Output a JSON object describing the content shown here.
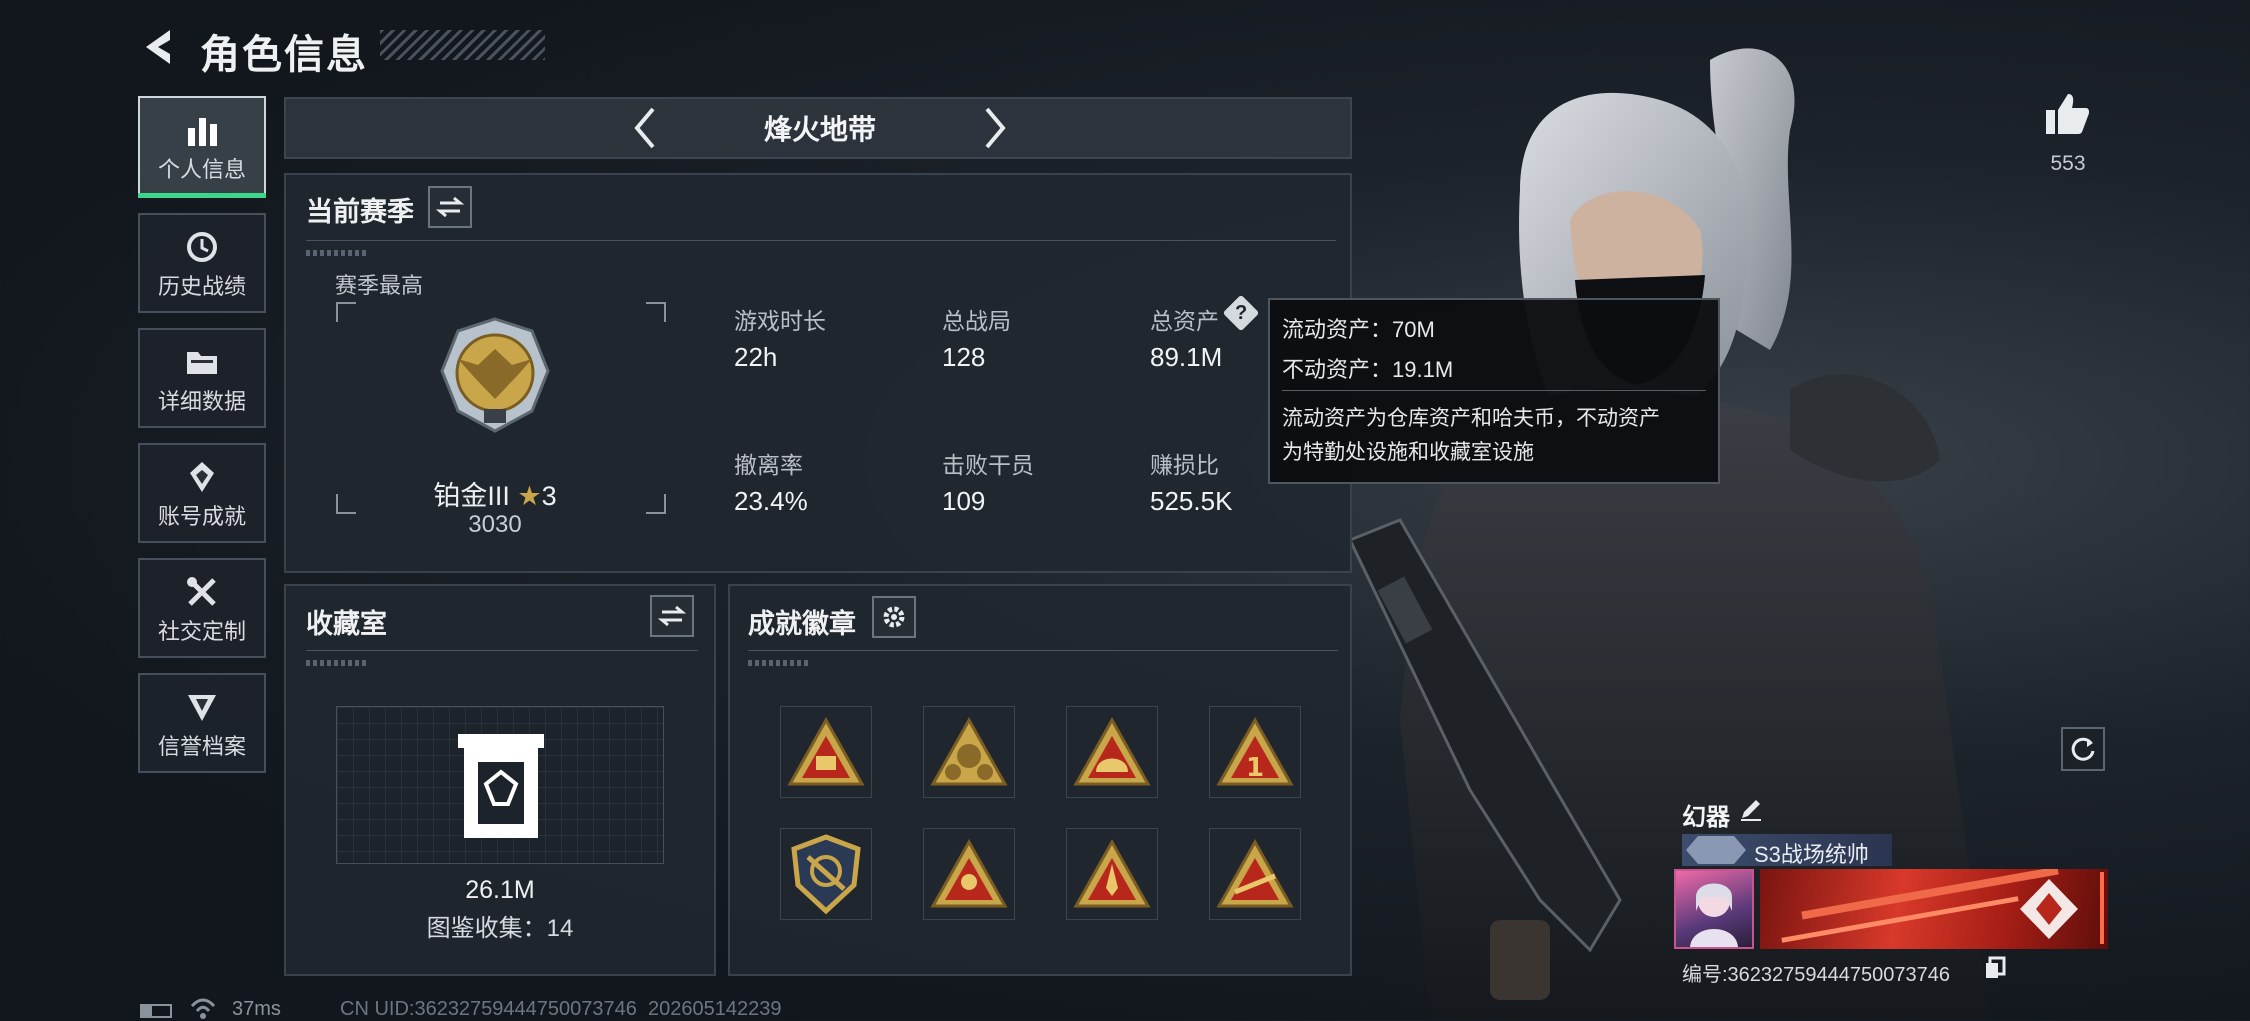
{
  "header": {
    "title": "角色信息",
    "back_icon": "back-arrow-icon"
  },
  "sidebar": {
    "items": [
      {
        "label": "个人信息",
        "icon": "bar-chart-icon",
        "active": true
      },
      {
        "label": "历史战绩",
        "icon": "history-icon",
        "active": false
      },
      {
        "label": "详细数据",
        "icon": "folder-icon",
        "active": false
      },
      {
        "label": "账号成就",
        "icon": "achievement-icon",
        "active": false
      },
      {
        "label": "社交定制",
        "icon": "tools-icon",
        "active": false
      },
      {
        "label": "信誉档案",
        "icon": "shield-icon",
        "active": false
      }
    ]
  },
  "mode_switcher": {
    "label": "烽火地带"
  },
  "season": {
    "title": "当前赛季",
    "best_label": "赛季最高",
    "rank_name": "铂金III",
    "rank_stars": "3",
    "rank_score": "3030",
    "stats": [
      {
        "label": "游戏时长",
        "value": "22h"
      },
      {
        "label": "总战局",
        "value": "128"
      },
      {
        "label": "总资产",
        "value": "89.1M"
      },
      {
        "label": "撤离率",
        "value": "23.4%"
      },
      {
        "label": "击败干员",
        "value": "109"
      },
      {
        "label": "赚损比",
        "value": "525.5K"
      }
    ]
  },
  "tooltip": {
    "liquid": "流动资产：70M",
    "fixed": "不动资产：19.1M",
    "desc_line1": "流动资产为仓库资产和哈夫币，不动资产",
    "desc_line2": "为特勤处设施和收藏室设施"
  },
  "collection": {
    "title": "收藏室",
    "value": "26.1M",
    "collect_label": "图鉴收集：14"
  },
  "badges": {
    "title": "成就徽章",
    "items": [
      "supply-badge-icon",
      "squad-badge-icon",
      "helmet-badge-icon",
      "rank-one-badge-icon",
      "crest-badge-icon",
      "team-badge-icon",
      "rocket-badge-icon",
      "sniper-badge-icon"
    ]
  },
  "profile": {
    "likes": "553",
    "name": "幻器",
    "title_tag": "S3战场统帅",
    "id_line": "编号:36232759444750073746"
  },
  "status_bar": {
    "ping": "37ms",
    "uid": "CN UID:36232759444750073746  202605142239"
  },
  "colors": {
    "accent_green": "#3dd68c",
    "gold": "#c9a64a",
    "badge_red": "#b7271c"
  }
}
